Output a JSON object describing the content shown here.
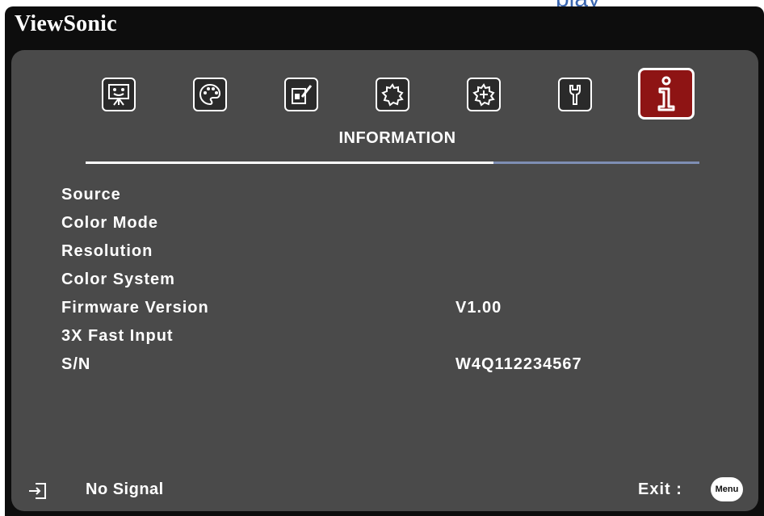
{
  "top_fragment": "play",
  "brand": "ViewSonic",
  "tabs": [
    {
      "icon": "display-icon",
      "active": false
    },
    {
      "icon": "color-palette-icon",
      "active": false
    },
    {
      "icon": "picture-adjust-icon",
      "active": false
    },
    {
      "icon": "basic-settings-icon",
      "active": false
    },
    {
      "icon": "advanced-settings-icon",
      "active": false
    },
    {
      "icon": "system-tools-icon",
      "active": false
    },
    {
      "icon": "information-icon",
      "active": true
    }
  ],
  "menu_title": "INFORMATION",
  "rows": [
    {
      "label": "Source",
      "value": ""
    },
    {
      "label": "Color Mode",
      "value": ""
    },
    {
      "label": "Resolution",
      "value": ""
    },
    {
      "label": "Color System",
      "value": ""
    },
    {
      "label": "Firmware Version",
      "value": "V1.00"
    },
    {
      "label": "3X Fast Input",
      "value": ""
    },
    {
      "label": "S/N",
      "value": "W4Q112234567"
    }
  ],
  "footer": {
    "signal": "No Signal",
    "exit_label": "Exit :",
    "menu_button": "Menu"
  },
  "colors": {
    "panel": "#4a4a4a",
    "active_tab": "#8e1414",
    "divider": "#7e8eb4",
    "frame": "#0d0d0d"
  }
}
